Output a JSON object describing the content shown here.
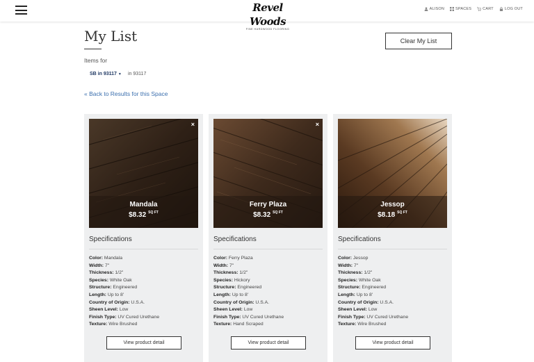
{
  "header": {
    "logo": "Revel Woods",
    "logo_sub": "FINE HARDWOOD FLOORING",
    "nav": [
      {
        "label": "ALISON",
        "icon": "user-icon"
      },
      {
        "label": "SPACES",
        "icon": "grid-icon"
      },
      {
        "label": "CART",
        "icon": "cart-icon"
      },
      {
        "label": "LOG OUT",
        "icon": "lock-icon"
      }
    ]
  },
  "page": {
    "title": "My List",
    "clear_label": "Clear My List",
    "items_for": "Items for",
    "space_selected": "SB in 93117",
    "zip_text": "in 93117",
    "back_link": "« Back to Results for this Space"
  },
  "cards": [
    {
      "name": "Mandala",
      "price": "$8.32",
      "unit": "SQ FT",
      "remove": "×",
      "spec_title": "Specifications",
      "specs": [
        {
          "label": "Color:",
          "value": "Mandala"
        },
        {
          "label": "Width:",
          "value": "7\""
        },
        {
          "label": "Thickness:",
          "value": "1/2\""
        },
        {
          "label": "Species:",
          "value": "White Oak"
        },
        {
          "label": "Structure:",
          "value": "Engineered"
        },
        {
          "label": "Length:",
          "value": "Up to 8'"
        },
        {
          "label": "Country of Origin:",
          "value": "U.S.A."
        },
        {
          "label": "Sheen Level:",
          "value": "Low"
        },
        {
          "label": "Finish Type:",
          "value": "UV Cured Urethane"
        },
        {
          "label": "Texture:",
          "value": "Wire Brushed"
        }
      ],
      "button": "View product detail",
      "colors": [
        "#3a2a1e",
        "#1f1610",
        "#5a4330"
      ]
    },
    {
      "name": "Ferry Plaza",
      "price": "$8.32",
      "unit": "SQ FT",
      "remove": "×",
      "spec_title": "Specifications",
      "specs": [
        {
          "label": "Color:",
          "value": "Ferry Plaza"
        },
        {
          "label": "Width:",
          "value": "7\""
        },
        {
          "label": "Thickness:",
          "value": "1/2\""
        },
        {
          "label": "Species:",
          "value": "Hickory"
        },
        {
          "label": "Structure:",
          "value": "Engineered"
        },
        {
          "label": "Length:",
          "value": "Up to 8'"
        },
        {
          "label": "Country of Origin:",
          "value": "U.S.A."
        },
        {
          "label": "Sheen Level:",
          "value": "Low"
        },
        {
          "label": "Finish Type:",
          "value": "UV Cured Urethane"
        },
        {
          "label": "Texture:",
          "value": "Hand Scraped"
        }
      ],
      "button": "View product detail",
      "colors": [
        "#4a3222",
        "#2a1c12",
        "#6b4a30"
      ]
    },
    {
      "name": "Jessop",
      "price": "$8.18",
      "unit": "SQ FT",
      "remove": "",
      "spec_title": "Specifications",
      "specs": [
        {
          "label": "Color:",
          "value": "Jessop"
        },
        {
          "label": "Width:",
          "value": "7\""
        },
        {
          "label": "Thickness:",
          "value": "1/2\""
        },
        {
          "label": "Species:",
          "value": "White Oak"
        },
        {
          "label": "Structure:",
          "value": "Engineered"
        },
        {
          "label": "Length:",
          "value": "Up to 8'"
        },
        {
          "label": "Country of Origin:",
          "value": "U.S.A."
        },
        {
          "label": "Sheen Level:",
          "value": "Low"
        },
        {
          "label": "Finish Type:",
          "value": "UV Cured Urethane"
        },
        {
          "label": "Texture:",
          "value": "Wire Brushed"
        }
      ],
      "button": "View product detail",
      "colors": [
        "#5b3a20",
        "#2b1a0e",
        "#c9a27a"
      ]
    }
  ]
}
